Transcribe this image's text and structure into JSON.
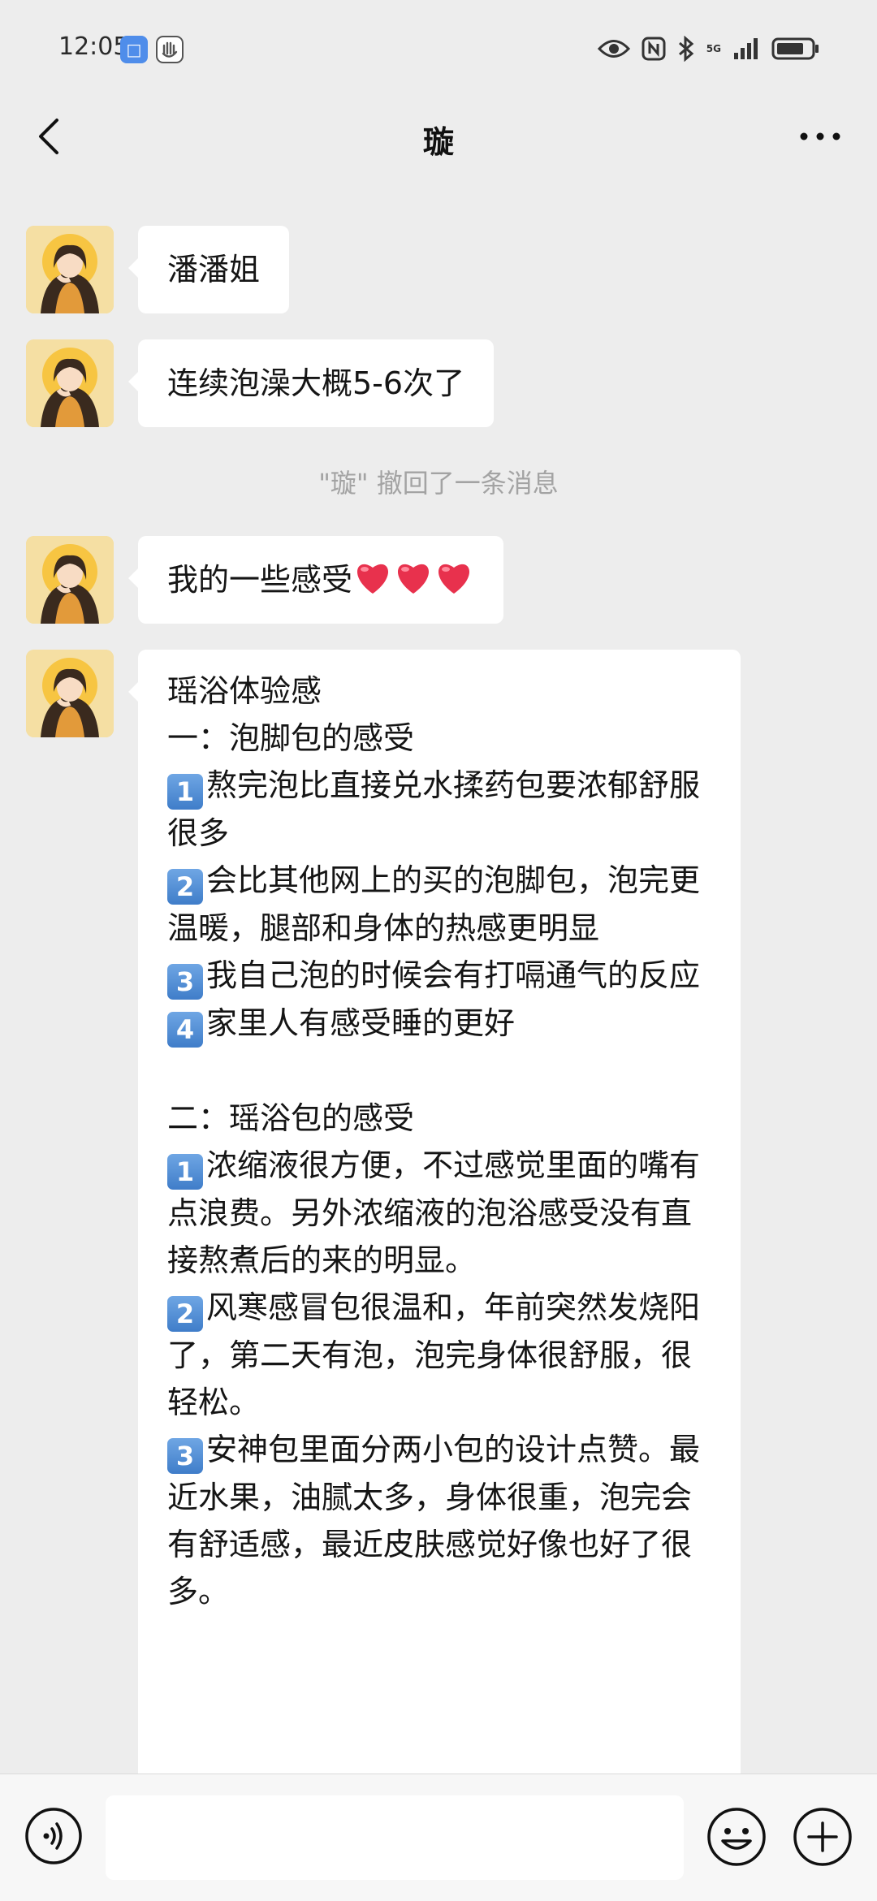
{
  "status_bar": {
    "time": "12:05",
    "network_label": "5G"
  },
  "nav": {
    "title": "璇"
  },
  "messages": [
    {
      "text": "潘潘姐"
    },
    {
      "text": "连续泡澡大概5-6次了"
    },
    {
      "text": "我的一些感受"
    },
    {
      "lines": [
        {
          "text": "瑶浴体验感"
        },
        {
          "text": "一：泡脚包的感受"
        },
        {
          "badge": "1",
          "text": "熬完泡比直接兑水揉药包要浓郁舒服很多"
        },
        {
          "badge": "2",
          "text": "会比其他网上的买的泡脚包，泡完更温暖，腿部和身体的热感更明显"
        },
        {
          "badge": "3",
          "text": "我自己泡的时候会有打嗝通气的反应"
        },
        {
          "badge": "4",
          "text": "家里人有感受睡的更好"
        },
        {
          "text": ""
        },
        {
          "text": "二：瑶浴包的感受"
        },
        {
          "badge": "1",
          "text": "浓缩液很方便，不过感觉里面的嘴有点浪费。另外浓缩液的泡浴感受没有直接熬煮后的来的明显。"
        },
        {
          "badge": "2",
          "text": "风寒感冒包很温和，年前突然发烧阳了，第二天有泡，泡完身体很舒服，很轻松。"
        },
        {
          "badge": "3",
          "text": "安神包里面分两小包的设计点赞。最近水果，油腻太多，身体很重，泡完会有舒适感，最近皮肤感觉好像也好了很多。"
        }
      ]
    }
  ],
  "recall_notice": "\"璇\" 撤回了一条消息",
  "input": {
    "value": ""
  },
  "colors": {
    "background": "#ededed",
    "bubble": "#ffffff",
    "heart": "#e8314d",
    "badge": "#4f86d0"
  },
  "icons": [
    "back-arrow-icon",
    "more-icon",
    "voice-icon",
    "emoji-icon",
    "plus-icon",
    "eye-icon",
    "nfc-icon",
    "bluetooth-icon",
    "signal-icon",
    "battery-icon"
  ]
}
